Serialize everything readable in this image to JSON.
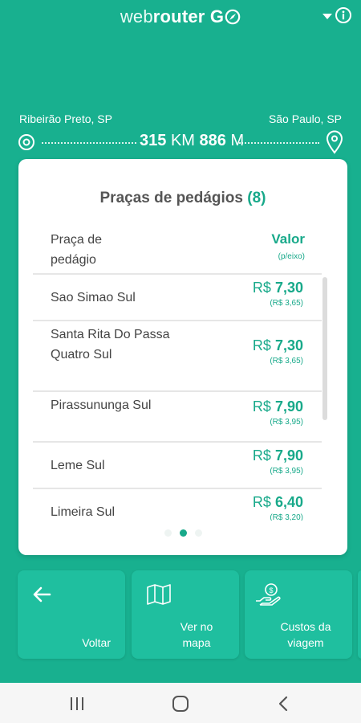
{
  "header": {
    "logo_part1": "web",
    "logo_part2": "router",
    "logo_part3": "G",
    "dropdown_icon": "caret-down-icon",
    "info_icon": "info-icon"
  },
  "route": {
    "origin": "Ribeirão Preto, SP",
    "destination": "São Paulo, SP",
    "km_value": "315",
    "km_unit": "KM",
    "m_value": "886",
    "m_unit": "M"
  },
  "tolls_card": {
    "title": "Praças de pedágios",
    "count": "(8)",
    "header_name": "Praça de pedágio",
    "header_value": "Valor",
    "header_value_sub": "(p/eixo)",
    "currency": "R$",
    "rows": [
      {
        "name": "Sao Simao Sul",
        "price": "7,30",
        "per_axle": "(R$ 3,65)"
      },
      {
        "name": "Santa Rita Do Passa Quatro Sul",
        "price": "7,30",
        "per_axle": "(R$ 3,65)"
      },
      {
        "name": "Pirassununga Sul",
        "price": "7,90",
        "per_axle": "(R$ 3,95)"
      },
      {
        "name": "Leme Sul",
        "price": "7,90",
        "per_axle": "(R$ 3,95)"
      },
      {
        "name": "Limeira Sul",
        "price": "6,40",
        "per_axle": "(R$ 3,20)"
      }
    ],
    "pages": 3,
    "active_page": 2
  },
  "actions": {
    "back_label": "Voltar",
    "map_label": "Ver no mapa",
    "cost_label": "Custos da viagem"
  },
  "colors": {
    "primary": "#18b08f",
    "tile": "#1fbf9f",
    "accent_text": "#18a98a"
  }
}
